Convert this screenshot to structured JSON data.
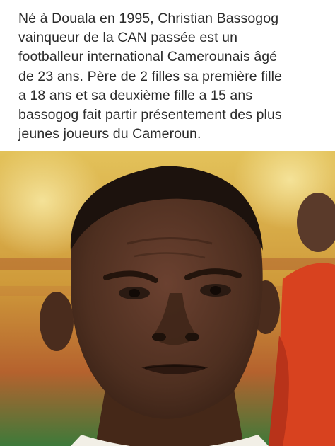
{
  "post": {
    "text_lines": [
      "Né à Douala en 1995, Christian Bassogog",
      "vainqueur de la CAN passée  est un",
      "footballeur international Camerounais âgé",
      "de 23 ans. Père de 2 filles sa première fille",
      "a 18 ans et sa deuxième fille a 15 ans",
      "bassogog fait partir présentement des plus",
      "jeunes joueurs du Cameroun."
    ]
  },
  "photo": {
    "subject": "portrait-of-footballer",
    "colors": {
      "stadium_background": "#d9b04a",
      "skin": "#5a3726",
      "shirt": "#f2efe6",
      "background_player_kit": "#d8421f"
    }
  }
}
